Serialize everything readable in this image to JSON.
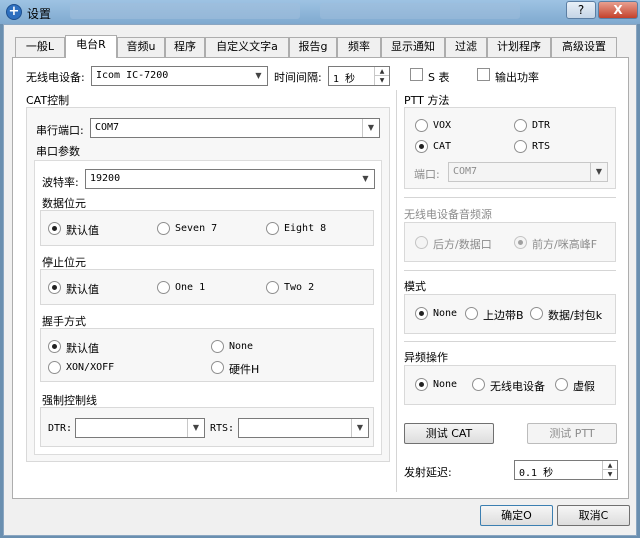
{
  "window": {
    "title": "设置",
    "help_label": "?",
    "close_label": "X"
  },
  "tabs": [
    {
      "label": "一般L",
      "active": false
    },
    {
      "label": "电台R",
      "active": true
    },
    {
      "label": "音频u",
      "active": false
    },
    {
      "label": "程序",
      "active": false
    },
    {
      "label": "自定义文字a",
      "active": false
    },
    {
      "label": "报告g",
      "active": false
    },
    {
      "label": "频率",
      "active": false
    },
    {
      "label": "显示通知",
      "active": false
    },
    {
      "label": "过滤",
      "active": false
    },
    {
      "label": "计划程序",
      "active": false
    },
    {
      "label": "高级设置",
      "active": false
    }
  ],
  "radio": {
    "rig_label": "无线电设备:",
    "rig_value": "Icom IC-7200",
    "interval_label": "时间间隔:",
    "interval_value": "1 秒",
    "s_meter_label": "S 表",
    "output_power_label": "输出功率"
  },
  "cat": {
    "group_label": "CAT控制",
    "serial_port_label": "串行端口:",
    "serial_port_value": "COM7",
    "serial_params_label": "串口参数",
    "baud_label": "波特率:",
    "baud_value": "19200",
    "data_bits_label": "数据位元",
    "data_bits_options": [
      "默认值",
      "Seven 7",
      "Eight 8"
    ],
    "stop_bits_label": "停止位元",
    "stop_bits_options": [
      "默认值",
      "One 1",
      "Two 2"
    ],
    "handshake_label": "握手方式",
    "handshake_options": [
      "默认值",
      "None",
      "XON/XOFF",
      "硬件H"
    ],
    "force_lines_label": "强制控制线",
    "dtr_label": "DTR:",
    "dtr_value": "",
    "rts_label": "RTS:",
    "rts_value": ""
  },
  "ptt": {
    "group_label": "PTT 方法",
    "options": [
      "VOX",
      "DTR",
      "CAT",
      "RTS"
    ],
    "port_label": "端口:",
    "port_value": "COM7"
  },
  "audio_source": {
    "group_label": "无线电设备音频源",
    "options": [
      "后方/数据口",
      "前方/咪高峰F"
    ]
  },
  "mode": {
    "group_label": "模式",
    "options": [
      "None",
      "上边带B",
      "数据/封包k"
    ]
  },
  "split": {
    "group_label": "异频操作",
    "options": [
      "None",
      "无线电设备",
      "虚假"
    ]
  },
  "buttons": {
    "test_cat": "测试 CAT",
    "test_ptt": "测试 PTT",
    "tx_delay_label": "发射延迟:",
    "tx_delay_value": "0.1 秒",
    "ok": "确定O",
    "cancel": "取消C"
  }
}
